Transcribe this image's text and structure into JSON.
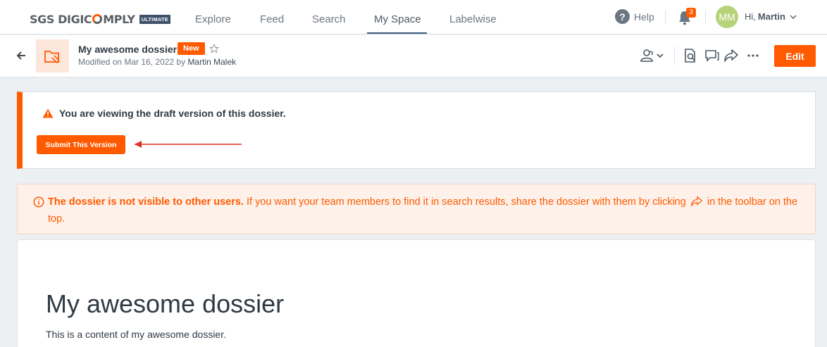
{
  "brand": {
    "logo_prefix": "SGS DIGIC",
    "logo_suffix": "MPLY",
    "tier_badge": "ULTIMATE"
  },
  "nav": {
    "items": [
      {
        "label": "Explore"
      },
      {
        "label": "Feed"
      },
      {
        "label": "Search"
      },
      {
        "label": "My Space"
      },
      {
        "label": "Labelwise"
      }
    ],
    "active": "My Space"
  },
  "topright": {
    "help_label": "Help",
    "help_icon": "question-circle-icon",
    "notification_count": "3",
    "avatar_initials": "MM",
    "greeting_prefix": "Hi,",
    "user_name": "Martin"
  },
  "header": {
    "title": "My awesome dossier",
    "badge": "New",
    "modified_prefix": "Modified on Mar 16, 2022 by",
    "modified_by": "Martin Malek",
    "edit_label": "Edit"
  },
  "draft": {
    "message": "You are viewing the draft version of this dossier.",
    "submit_label": "Submit This Version"
  },
  "notice": {
    "bold": "The dossier is not visible to other users.",
    "text_before_icon": " If you want your team members to find it in search results, share the dossier with them by clicking",
    "text_after_icon": " in the toolbar on the top."
  },
  "content": {
    "title": "My awesome dossier",
    "body": "This is a content of my awesome dossier."
  },
  "colors": {
    "accent": "#ff5a00",
    "avatar": "#b7d37a",
    "nav_underline": "#3d5a80",
    "notice_bg": "#fdf1ea"
  }
}
